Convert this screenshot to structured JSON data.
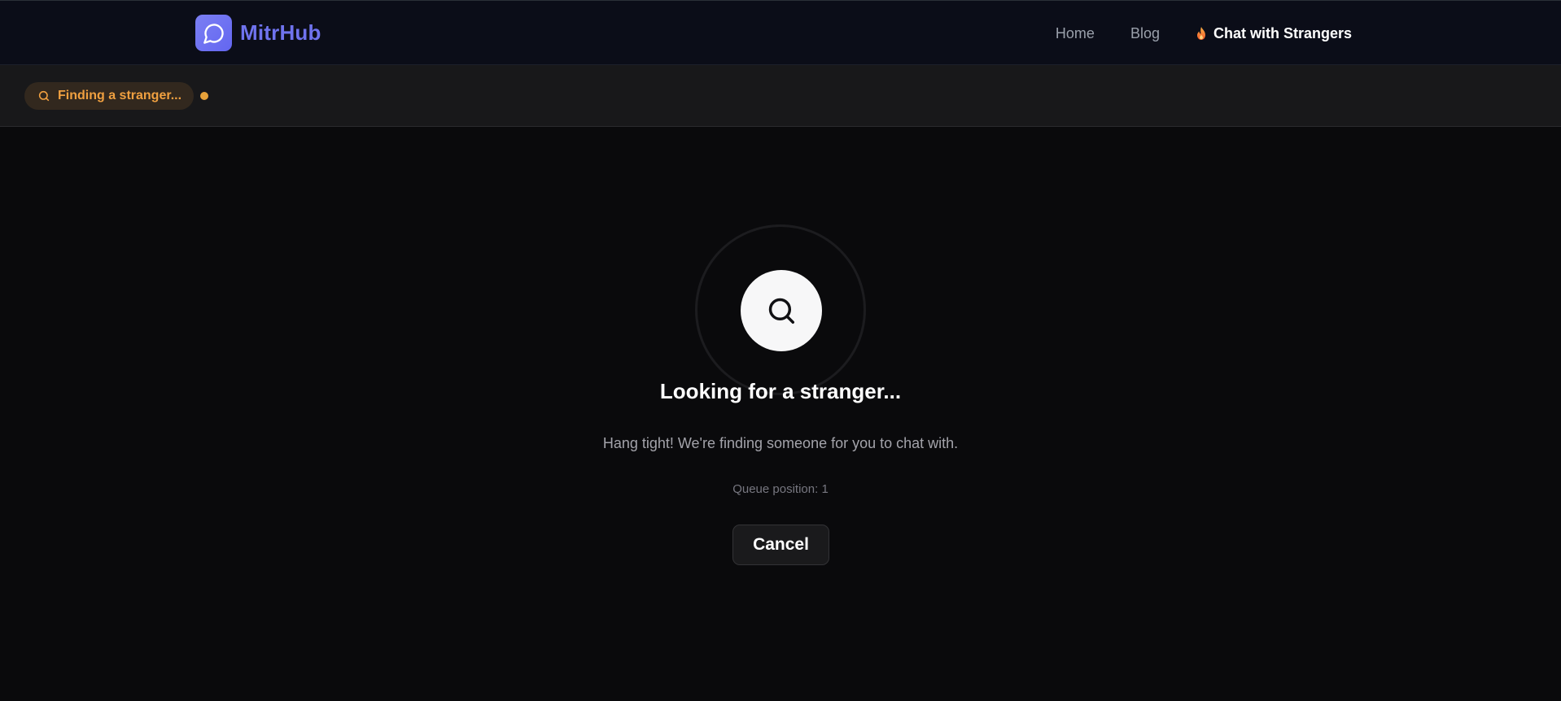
{
  "nav": {
    "brand_name": "MitrHub",
    "brand_icon": "chat-bubble-icon",
    "brand_color": "#6f73ee",
    "links": [
      {
        "label": "Home"
      },
      {
        "label": "Blog"
      },
      {
        "label": "Chat with Strangers",
        "icon": "flame-icon",
        "active": true
      }
    ]
  },
  "status": {
    "label": "Finding a stranger...",
    "icon": "search-icon",
    "color": "#f0a040"
  },
  "main": {
    "icon": "search-icon",
    "title": "Looking for a stranger...",
    "subtitle": "Hang tight! We're finding someone for you to chat with.",
    "queue_text": "Queue position: 1",
    "cancel_label": "Cancel"
  }
}
